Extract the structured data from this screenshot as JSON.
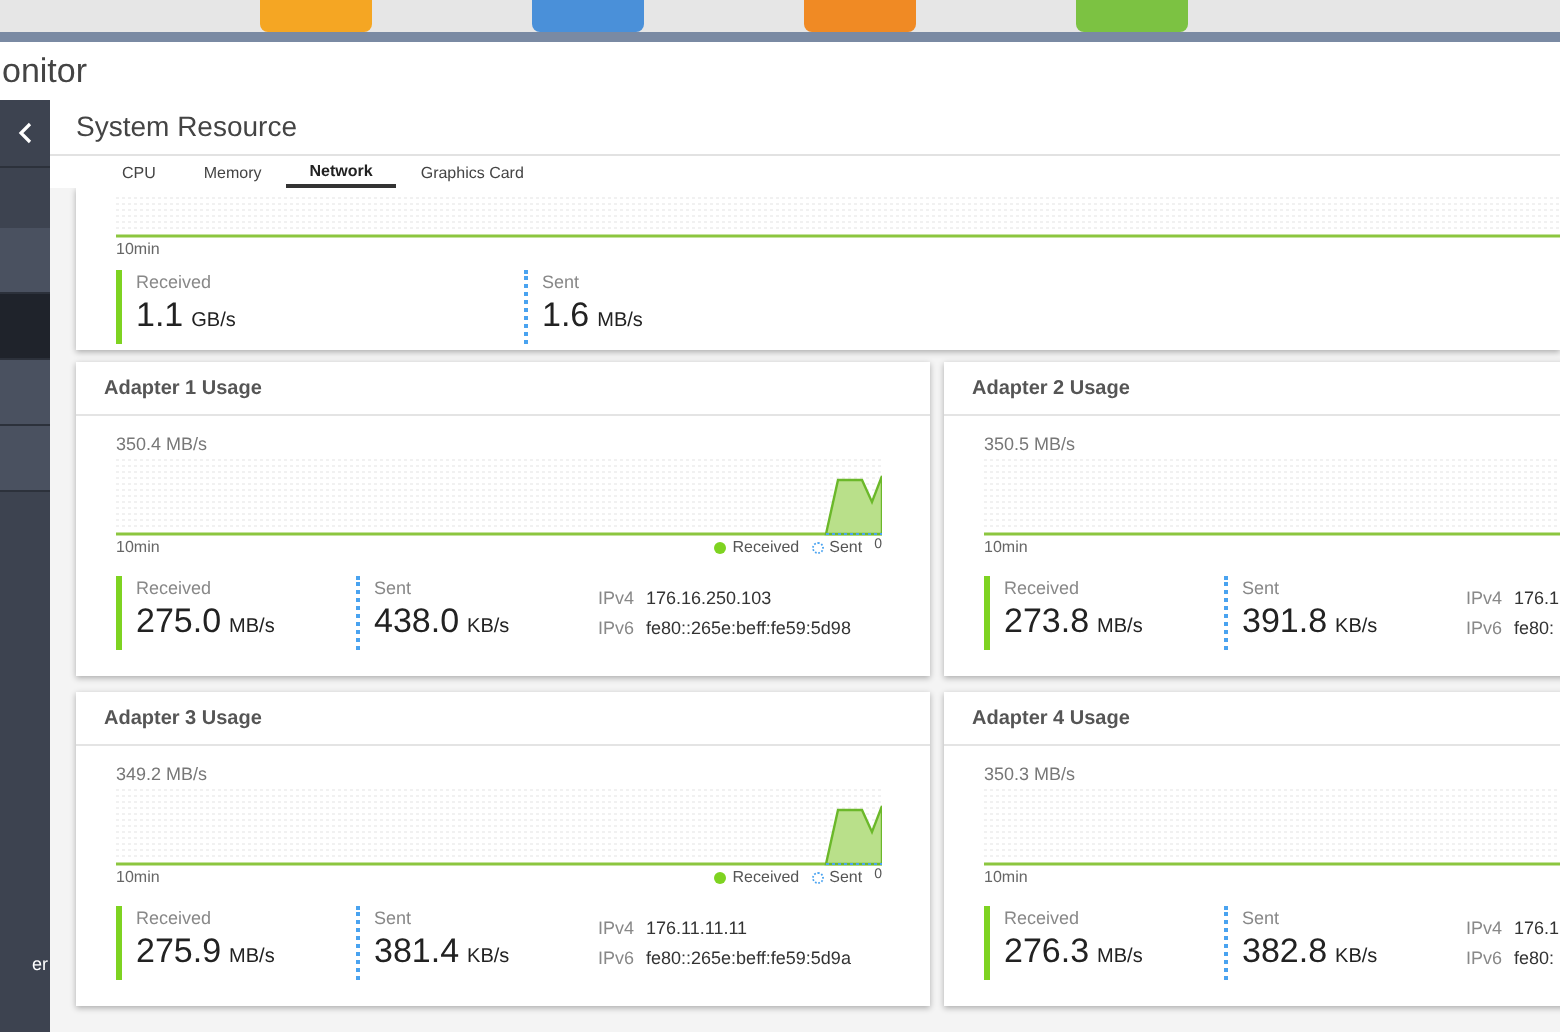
{
  "desktop_icons": [
    {
      "color": "#f5a623"
    },
    {
      "color": "#4a90d9"
    },
    {
      "color": "#f08a24"
    },
    {
      "color": "#7cc242"
    }
  ],
  "window": {
    "title": "onitor"
  },
  "sidebar": {
    "items": [
      {
        "selected": false
      },
      {
        "selected": true
      },
      {
        "selected": false
      },
      {
        "selected": false
      }
    ],
    "footer_label": "er"
  },
  "page_title": "System Resource",
  "tabs": [
    {
      "label": "CPU",
      "selected": false
    },
    {
      "label": "Memory",
      "selected": false
    },
    {
      "label": "Network",
      "selected": true
    },
    {
      "label": "Graphics Card",
      "selected": false
    }
  ],
  "overview": {
    "time_label": "10min",
    "received": {
      "label": "Received",
      "value": "1.1",
      "unit": "GB/s"
    },
    "sent": {
      "label": "Sent",
      "value": "1.6",
      "unit": "MB/s"
    }
  },
  "adapters": [
    {
      "title": "Adapter 1 Usage",
      "max_label": "350.4 MB/s",
      "time_label": "10min",
      "spike": true,
      "legend": {
        "received": "Received",
        "sent": "Sent",
        "zero": "0"
      },
      "received": {
        "label": "Received",
        "value": "275.0",
        "unit": "MB/s"
      },
      "sent": {
        "label": "Sent",
        "value": "438.0",
        "unit": "KB/s"
      },
      "ipv4": {
        "label": "IPv4",
        "value": "176.16.250.103"
      },
      "ipv6": {
        "label": "IPv6",
        "value": "fe80::265e:beff:fe59:5d98"
      }
    },
    {
      "title": "Adapter 2 Usage",
      "max_label": "350.5 MB/s",
      "time_label": "10min",
      "received": {
        "label": "Received",
        "value": "273.8",
        "unit": "MB/s"
      },
      "sent": {
        "label": "Sent",
        "value": "391.8",
        "unit": "KB/s"
      },
      "ipv4": {
        "label": "IPv4",
        "value": "176.1"
      },
      "ipv6": {
        "label": "IPv6",
        "value": "fe80:"
      }
    },
    {
      "title": "Adapter 3 Usage",
      "max_label": "349.2 MB/s",
      "time_label": "10min",
      "spike": true,
      "legend": {
        "received": "Received",
        "sent": "Sent",
        "zero": "0"
      },
      "received": {
        "label": "Received",
        "value": "275.9",
        "unit": "MB/s"
      },
      "sent": {
        "label": "Sent",
        "value": "381.4",
        "unit": "KB/s"
      },
      "ipv4": {
        "label": "IPv4",
        "value": "176.11.11.11"
      },
      "ipv6": {
        "label": "IPv6",
        "value": "fe80::265e:beff:fe59:5d9a"
      }
    },
    {
      "title": "Adapter 4 Usage",
      "max_label": "350.3 MB/s",
      "time_label": "10min",
      "received": {
        "label": "Received",
        "value": "276.3",
        "unit": "MB/s"
      },
      "sent": {
        "label": "Sent",
        "value": "382.8",
        "unit": "KB/s"
      },
      "ipv4": {
        "label": "IPv4",
        "value": "176.1"
      },
      "ipv6": {
        "label": "IPv6",
        "value": "fe80:"
      }
    }
  ]
}
